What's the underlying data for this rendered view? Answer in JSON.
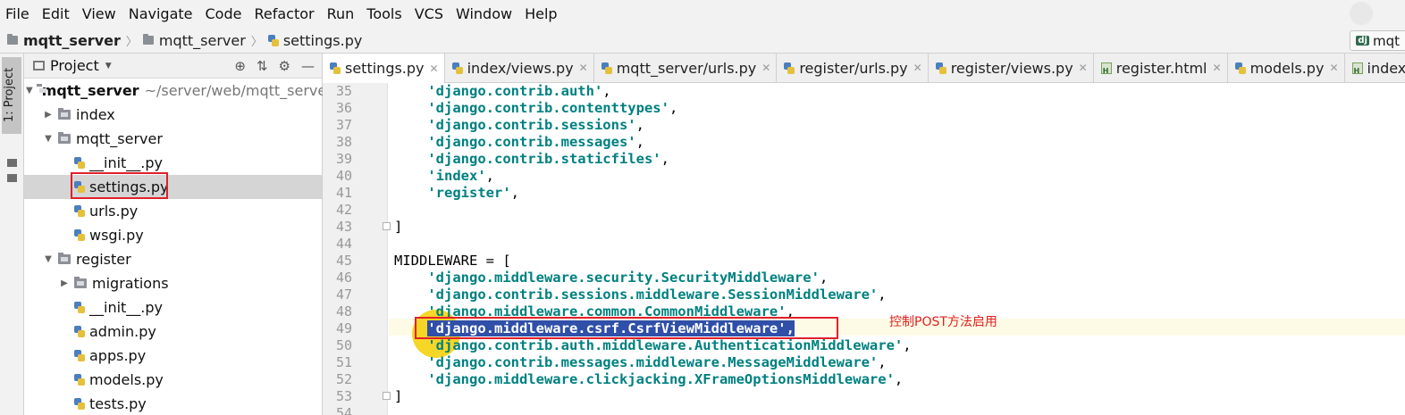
{
  "menu": [
    "File",
    "Edit",
    "View",
    "Navigate",
    "Code",
    "Refactor",
    "Run",
    "Tools",
    "VCS",
    "Window",
    "Help"
  ],
  "breadcrumb": {
    "root": "mqtt_server",
    "folder": "mqtt_server",
    "file": "settings.py"
  },
  "run_config": {
    "label": "mqt"
  },
  "toolstrip": {
    "project_tab": "1: Project"
  },
  "project_panel": {
    "title": "Project"
  },
  "tree": [
    {
      "label": "mqtt_server",
      "path": "~/server/web/mqtt_server"
    },
    {
      "label": "index"
    },
    {
      "label": "mqtt_server"
    },
    {
      "label": "__init__.py"
    },
    {
      "label": "settings.py"
    },
    {
      "label": "urls.py"
    },
    {
      "label": "wsgi.py"
    },
    {
      "label": "register"
    },
    {
      "label": "migrations"
    },
    {
      "label": "__init__.py"
    },
    {
      "label": "admin.py"
    },
    {
      "label": "apps.py"
    },
    {
      "label": "models.py"
    },
    {
      "label": "tests.py"
    }
  ],
  "tabs": [
    "settings.py",
    "index/views.py",
    "mqtt_server/urls.py",
    "register/urls.py",
    "register/views.py",
    "register.html",
    "models.py",
    "index.html"
  ],
  "editor": {
    "line_numbers": [
      "35",
      "36",
      "37",
      "38",
      "39",
      "40",
      "41",
      "42",
      "43",
      "44",
      "45",
      "46",
      "47",
      "48",
      "49",
      "50",
      "51",
      "52",
      "53",
      "54"
    ],
    "lines": {
      "l35": "'django.contrib.auth'",
      "l36": "'django.contrib.contenttypes'",
      "l37": "'django.contrib.sessions'",
      "l38": "'django.contrib.messages'",
      "l39": "'django.contrib.staticfiles'",
      "l40": "'index'",
      "l41": "'register'",
      "l43": "]",
      "l45": "MIDDLEWARE = [",
      "l46": "'django.middleware.security.SecurityMiddleware'",
      "l47": "'django.contrib.sessions.middleware.SessionMiddleware'",
      "l48": "'django.middleware.common.CommonMiddleware'",
      "l49": "'django.middleware.csrf.CsrfViewMiddleware',",
      "l50": "'django.contrib.auth.middleware.AuthenticationMiddleware'",
      "l51": "'django.contrib.messages.middleware.MessageMiddleware'",
      "l52": "'django.middleware.clickjacking.XFrameOptionsMiddleware'",
      "l53": "]",
      "comma": ","
    },
    "annotation": "控制POST方法启用"
  }
}
